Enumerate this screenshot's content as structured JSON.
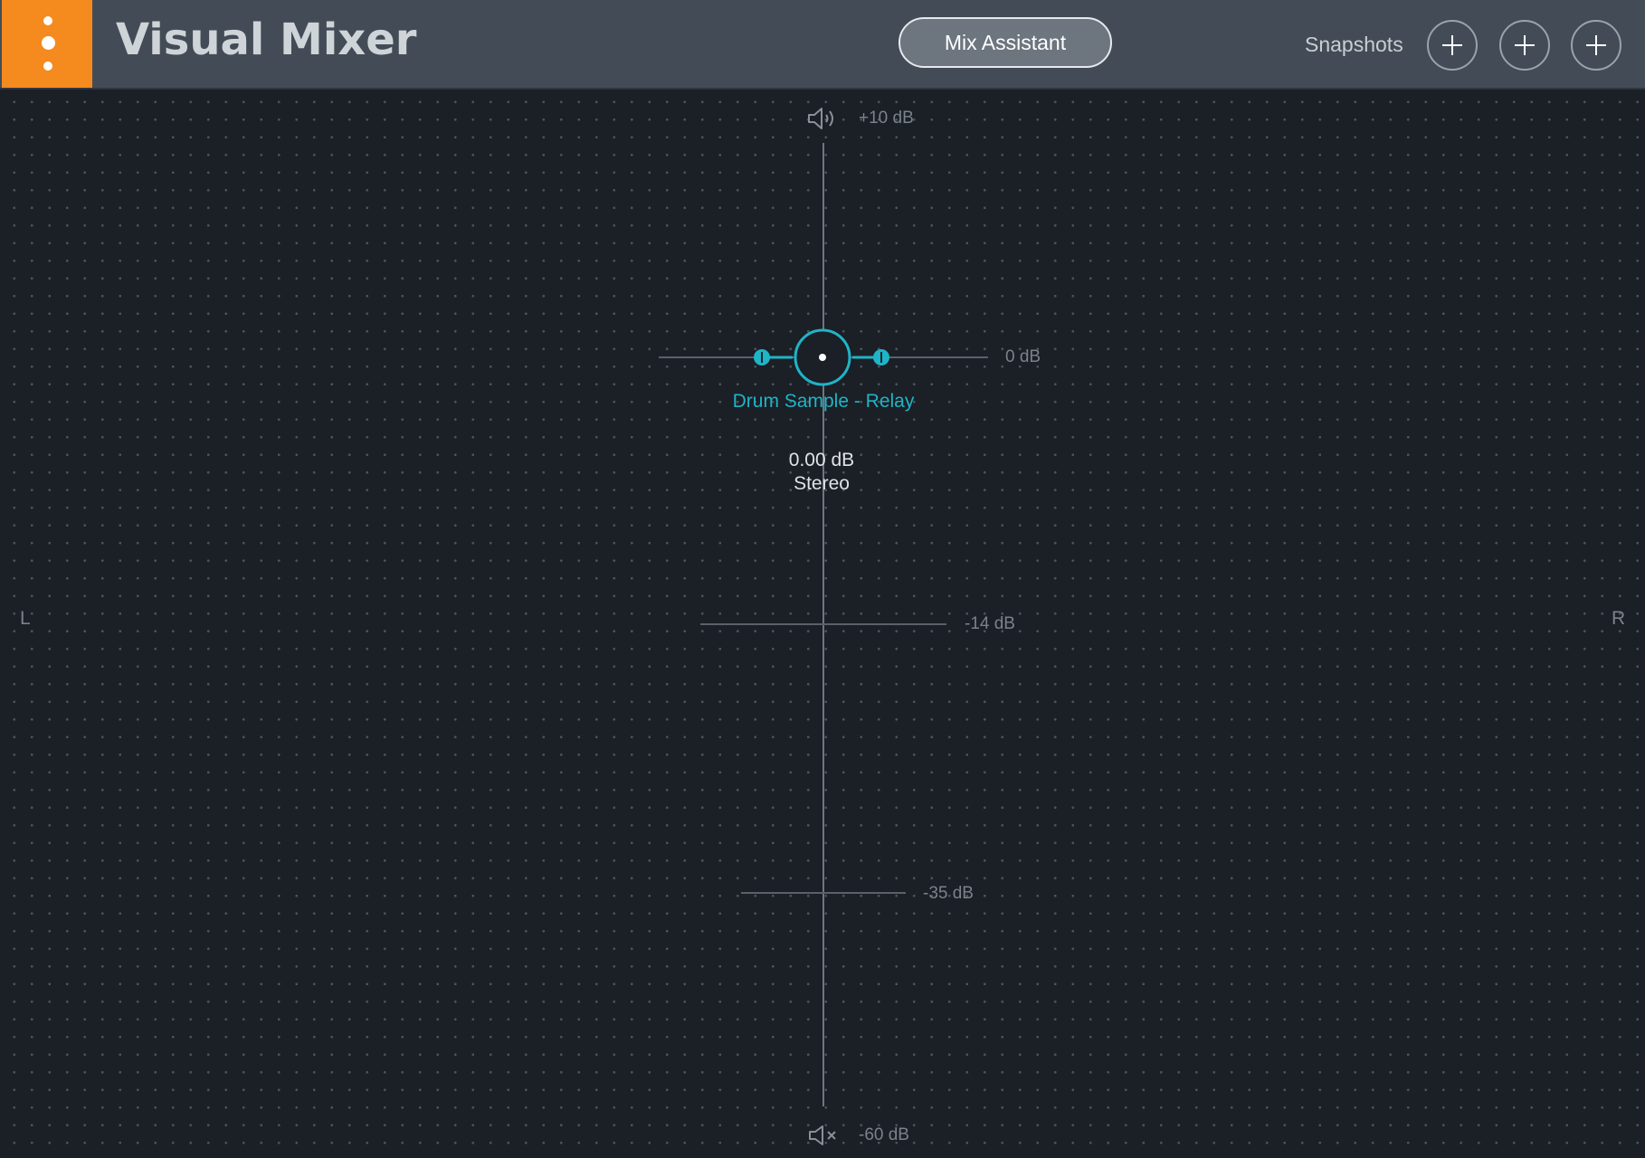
{
  "header": {
    "menu_icon": "vertical-dots-icon",
    "title": "Visual Mixer",
    "mix_assistant_label": "Mix Assistant",
    "snapshots_label": "Snapshots",
    "snapshot_slots": [
      {
        "icon": "plus-icon"
      },
      {
        "icon": "plus-icon"
      },
      {
        "icon": "plus-icon"
      }
    ]
  },
  "canvas": {
    "pan_left_label": "L",
    "pan_right_label": "R",
    "scale": {
      "top_label": "+10 dB",
      "top_icon": "speaker-loud-icon",
      "bottom_label": "-60 dB",
      "bottom_icon": "speaker-mute-icon",
      "marks": [
        "0 dB",
        "-14 dB",
        "-35 dB"
      ]
    },
    "track": {
      "name": "Drum Sample - Relay",
      "gain": "0.00 dB",
      "width_mode": "Stereo",
      "gain_db": 0.0,
      "pan": 0.0
    }
  },
  "colors": {
    "accent_orange": "#f58a1f",
    "track_teal": "#1fb4c6",
    "header_bg": "#434c56",
    "canvas_bg": "#1b1f26"
  }
}
